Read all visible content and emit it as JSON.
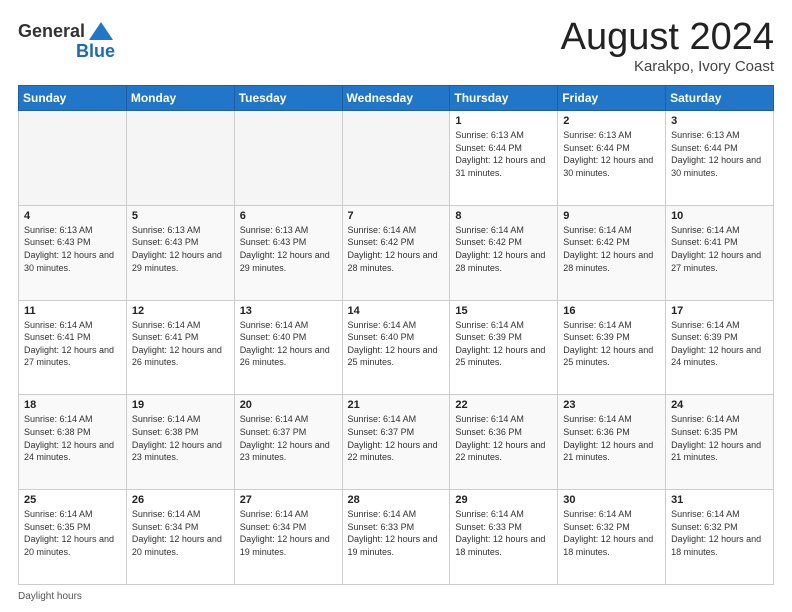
{
  "header": {
    "logo_general": "General",
    "logo_blue": "Blue",
    "title": "August 2024",
    "location": "Karakpo, Ivory Coast"
  },
  "weekdays": [
    "Sunday",
    "Monday",
    "Tuesday",
    "Wednesday",
    "Thursday",
    "Friday",
    "Saturday"
  ],
  "weeks": [
    [
      {
        "day": "",
        "info": ""
      },
      {
        "day": "",
        "info": ""
      },
      {
        "day": "",
        "info": ""
      },
      {
        "day": "",
        "info": ""
      },
      {
        "day": "1",
        "info": "Sunrise: 6:13 AM\nSunset: 6:44 PM\nDaylight: 12 hours and 31 minutes."
      },
      {
        "day": "2",
        "info": "Sunrise: 6:13 AM\nSunset: 6:44 PM\nDaylight: 12 hours and 30 minutes."
      },
      {
        "day": "3",
        "info": "Sunrise: 6:13 AM\nSunset: 6:44 PM\nDaylight: 12 hours and 30 minutes."
      }
    ],
    [
      {
        "day": "4",
        "info": "Sunrise: 6:13 AM\nSunset: 6:43 PM\nDaylight: 12 hours and 30 minutes."
      },
      {
        "day": "5",
        "info": "Sunrise: 6:13 AM\nSunset: 6:43 PM\nDaylight: 12 hours and 29 minutes."
      },
      {
        "day": "6",
        "info": "Sunrise: 6:13 AM\nSunset: 6:43 PM\nDaylight: 12 hours and 29 minutes."
      },
      {
        "day": "7",
        "info": "Sunrise: 6:14 AM\nSunset: 6:42 PM\nDaylight: 12 hours and 28 minutes."
      },
      {
        "day": "8",
        "info": "Sunrise: 6:14 AM\nSunset: 6:42 PM\nDaylight: 12 hours and 28 minutes."
      },
      {
        "day": "9",
        "info": "Sunrise: 6:14 AM\nSunset: 6:42 PM\nDaylight: 12 hours and 28 minutes."
      },
      {
        "day": "10",
        "info": "Sunrise: 6:14 AM\nSunset: 6:41 PM\nDaylight: 12 hours and 27 minutes."
      }
    ],
    [
      {
        "day": "11",
        "info": "Sunrise: 6:14 AM\nSunset: 6:41 PM\nDaylight: 12 hours and 27 minutes."
      },
      {
        "day": "12",
        "info": "Sunrise: 6:14 AM\nSunset: 6:41 PM\nDaylight: 12 hours and 26 minutes."
      },
      {
        "day": "13",
        "info": "Sunrise: 6:14 AM\nSunset: 6:40 PM\nDaylight: 12 hours and 26 minutes."
      },
      {
        "day": "14",
        "info": "Sunrise: 6:14 AM\nSunset: 6:40 PM\nDaylight: 12 hours and 25 minutes."
      },
      {
        "day": "15",
        "info": "Sunrise: 6:14 AM\nSunset: 6:39 PM\nDaylight: 12 hours and 25 minutes."
      },
      {
        "day": "16",
        "info": "Sunrise: 6:14 AM\nSunset: 6:39 PM\nDaylight: 12 hours and 25 minutes."
      },
      {
        "day": "17",
        "info": "Sunrise: 6:14 AM\nSunset: 6:39 PM\nDaylight: 12 hours and 24 minutes."
      }
    ],
    [
      {
        "day": "18",
        "info": "Sunrise: 6:14 AM\nSunset: 6:38 PM\nDaylight: 12 hours and 24 minutes."
      },
      {
        "day": "19",
        "info": "Sunrise: 6:14 AM\nSunset: 6:38 PM\nDaylight: 12 hours and 23 minutes."
      },
      {
        "day": "20",
        "info": "Sunrise: 6:14 AM\nSunset: 6:37 PM\nDaylight: 12 hours and 23 minutes."
      },
      {
        "day": "21",
        "info": "Sunrise: 6:14 AM\nSunset: 6:37 PM\nDaylight: 12 hours and 22 minutes."
      },
      {
        "day": "22",
        "info": "Sunrise: 6:14 AM\nSunset: 6:36 PM\nDaylight: 12 hours and 22 minutes."
      },
      {
        "day": "23",
        "info": "Sunrise: 6:14 AM\nSunset: 6:36 PM\nDaylight: 12 hours and 21 minutes."
      },
      {
        "day": "24",
        "info": "Sunrise: 6:14 AM\nSunset: 6:35 PM\nDaylight: 12 hours and 21 minutes."
      }
    ],
    [
      {
        "day": "25",
        "info": "Sunrise: 6:14 AM\nSunset: 6:35 PM\nDaylight: 12 hours and 20 minutes."
      },
      {
        "day": "26",
        "info": "Sunrise: 6:14 AM\nSunset: 6:34 PM\nDaylight: 12 hours and 20 minutes."
      },
      {
        "day": "27",
        "info": "Sunrise: 6:14 AM\nSunset: 6:34 PM\nDaylight: 12 hours and 19 minutes."
      },
      {
        "day": "28",
        "info": "Sunrise: 6:14 AM\nSunset: 6:33 PM\nDaylight: 12 hours and 19 minutes."
      },
      {
        "day": "29",
        "info": "Sunrise: 6:14 AM\nSunset: 6:33 PM\nDaylight: 12 hours and 18 minutes."
      },
      {
        "day": "30",
        "info": "Sunrise: 6:14 AM\nSunset: 6:32 PM\nDaylight: 12 hours and 18 minutes."
      },
      {
        "day": "31",
        "info": "Sunrise: 6:14 AM\nSunset: 6:32 PM\nDaylight: 12 hours and 18 minutes."
      }
    ]
  ],
  "footer": {
    "label": "Daylight hours"
  }
}
